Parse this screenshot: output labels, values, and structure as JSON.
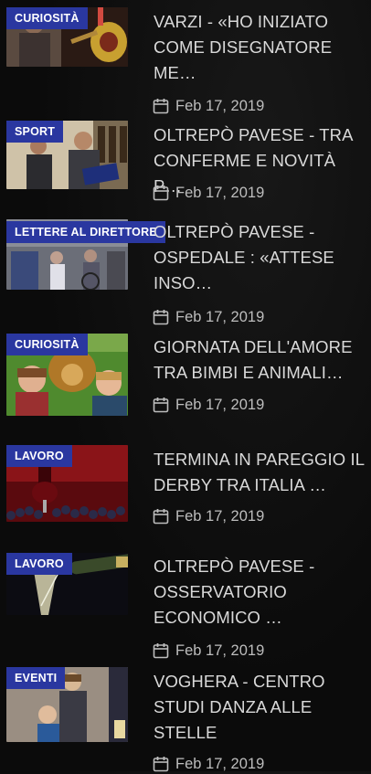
{
  "articles": [
    {
      "category": "CURIOSITÀ",
      "title": "VARZI - «HO INIZIATO COME DISEGNATORE ME…",
      "date": "Feb 17, 2019",
      "thumbnail_icon": "guitar-player-photo"
    },
    {
      "category": "SPORT",
      "title": "OLTREPÒ PAVESE - TRA CONFERME E NOVITÀ P…",
      "date": "Feb 17, 2019",
      "thumbnail_icon": "award-ceremony-photo"
    },
    {
      "category": "LETTERE AL DIRETTORE",
      "title": "OLTREPÒ PAVESE - OSPEDALE : «ATTESE INSO…",
      "date": "Feb 17, 2019",
      "thumbnail_icon": "hospital-waiting-room-photo"
    },
    {
      "category": "CURIOSITÀ",
      "title": "GIORNATA DELL'AMORE TRA BIMBI E ANIMALI…",
      "date": "Feb 17, 2019",
      "thumbnail_icon": "children-with-dog-photo"
    },
    {
      "category": "LAVORO",
      "title": "TERMINA IN PAREGGIO IL DERBY TRA ITALIA …",
      "date": "Feb 17, 2019",
      "thumbnail_icon": "wine-and-grapes-photo"
    },
    {
      "category": "LAVORO",
      "title": "OLTREPÒ PAVESE - OSSERVATORIO ECONOMICO …",
      "date": "Feb 17, 2019",
      "thumbnail_icon": "sparkling-wine-glass-photo"
    },
    {
      "category": "EVENTI",
      "title": "VOGHERA - CENTRO STUDI DANZA ALLE STELLE",
      "date": "Feb 17, 2019",
      "thumbnail_icon": "dancers-portrait-photo"
    }
  ],
  "colors": {
    "badge_bg": "#2a37a0",
    "title_text": "#d9d9d9",
    "meta_text": "#bdbdbd",
    "background": "#0b0b0b"
  },
  "icons": {
    "date": "calendar-icon"
  }
}
